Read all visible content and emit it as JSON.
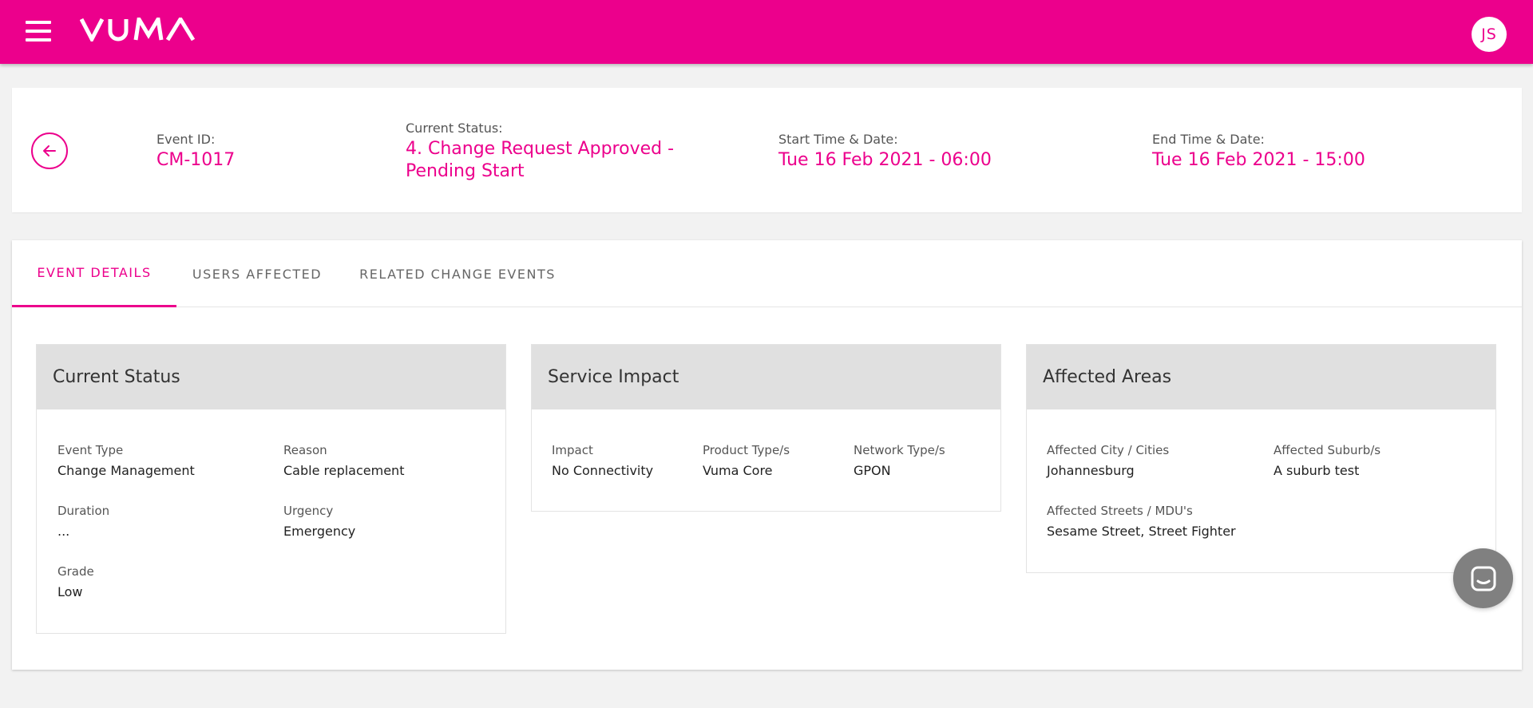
{
  "brand": {
    "name": "VUMA",
    "accent_color": "#ec008c"
  },
  "topbar": {
    "menu_icon": "hamburger-menu-icon",
    "user_initials": "JS"
  },
  "header": {
    "back_icon": "arrow-left-icon",
    "event_id_label": "Event ID:",
    "event_id": "CM-1017",
    "status_label": "Current Status:",
    "status": "4. Change Request Approved - Pending Start",
    "start_label": "Start Time & Date:",
    "start": "Tue 16 Feb 2021 - 06:00",
    "end_label": "End Time & Date:",
    "end": "Tue 16 Feb 2021 - 15:00"
  },
  "tabs": [
    {
      "label": "EVENT DETAILS",
      "active": true
    },
    {
      "label": "USERS AFFECTED",
      "active": false
    },
    {
      "label": "RELATED CHANGE EVENTS",
      "active": false
    }
  ],
  "panels": {
    "current_status": {
      "title": "Current Status",
      "event_type_label": "Event Type",
      "event_type": "Change Management",
      "reason_label": "Reason",
      "reason": "Cable replacement",
      "duration_label": "Duration",
      "duration": "...",
      "urgency_label": "Urgency",
      "urgency": "Emergency",
      "grade_label": "Grade",
      "grade": "Low"
    },
    "service_impact": {
      "title": "Service Impact",
      "impact_label": "Impact",
      "impact": "No Connectivity",
      "product_label": "Product Type/s",
      "product": "Vuma Core",
      "network_label": "Network Type/s",
      "network": "GPON"
    },
    "affected_areas": {
      "title": "Affected Areas",
      "city_label": "Affected City / Cities",
      "city": "Johannesburg",
      "suburb_label": "Affected Suburb/s",
      "suburb": "A suburb test",
      "streets_label": "Affected Streets / MDU's",
      "streets": "Sesame Street, Street Fighter"
    }
  },
  "chat": {
    "icon": "chat-bubble-icon"
  }
}
